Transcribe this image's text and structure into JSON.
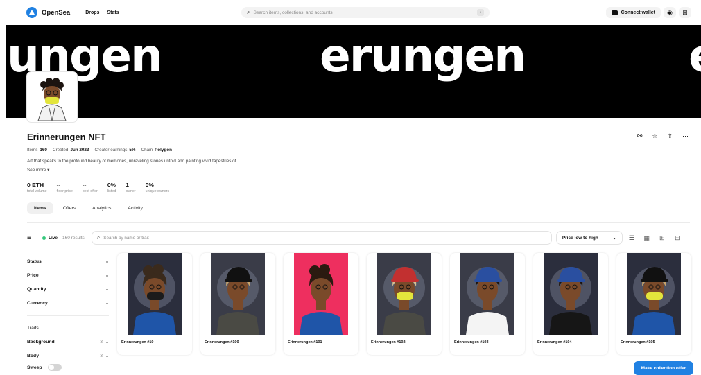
{
  "nav": {
    "logo_text": "OpenSea",
    "links": [
      "Drops",
      "Stats"
    ],
    "search_placeholder": "Search items, collections, and accounts",
    "search_shortcut": "/",
    "connect_wallet": "Connect wallet"
  },
  "banner": {
    "words": [
      "ungen",
      "erungen",
      "e"
    ]
  },
  "collection": {
    "title": "Erinnerungen NFT",
    "meta": {
      "items_label": "Items",
      "items_value": "160",
      "created_label": "Created",
      "created_value": "Jun 2023",
      "earnings_label": "Creator earnings",
      "earnings_value": "5%",
      "chain_label": "Chain",
      "chain_value": "Polygon"
    },
    "description": "Art that speaks to the profound beauty of memories, unraveling stories untold and painting vivid tapestries of...",
    "see_more": "See more",
    "stats": [
      {
        "value": "0 ETH",
        "label": "total volume"
      },
      {
        "value": "--",
        "label": "floor price"
      },
      {
        "value": "--",
        "label": "best offer"
      },
      {
        "value": "0%",
        "label": "listed"
      },
      {
        "value": "1",
        "label": "owner"
      },
      {
        "value": "0%",
        "label": "unique owners"
      }
    ]
  },
  "tabs": [
    "Items",
    "Offers",
    "Analytics",
    "Activity"
  ],
  "filter_bar": {
    "live": "Live",
    "results": "160 results",
    "search_placeholder": "Search by name or trait",
    "sort": "Price low to high"
  },
  "sidebar": {
    "filters": [
      "Status",
      "Price",
      "Quantity",
      "Currency"
    ],
    "traits_label": "Traits",
    "traits": [
      {
        "name": "Background",
        "count": "3"
      },
      {
        "name": "Body",
        "count": "3"
      }
    ]
  },
  "items": [
    {
      "name": "Erinnerungen #10",
      "bg": "#2b2e3d",
      "hair": "#3a2a1c",
      "mask": "#1b1b1b",
      "shirt": "#1f55a8",
      "cap": ""
    },
    {
      "name": "Erinnerungen #100",
      "bg": "#3a3c48",
      "hair": "#c9a46a",
      "mask": "",
      "shirt": "#4a4a44",
      "cap": "#111111"
    },
    {
      "name": "Erinnerungen #101",
      "bg": "#ee2f5f",
      "hair": "#2b1a10",
      "mask": "",
      "shirt": "#1f55a8",
      "cap": ""
    },
    {
      "name": "Erinnerungen #102",
      "bg": "#3a3c48",
      "hair": "#d8c090",
      "mask": "#e3e53c",
      "shirt": "#4a4a44",
      "cap": "#c23030"
    },
    {
      "name": "Erinnerungen #103",
      "bg": "#3a3c48",
      "hair": "#1e140d",
      "mask": "",
      "shirt": "#f4f4f4",
      "cap": "#2a4fa0"
    },
    {
      "name": "Erinnerungen #104",
      "bg": "#2b2e3d",
      "hair": "#1e140d",
      "mask": "",
      "shirt": "#161616",
      "cap": "#2a4fa0"
    },
    {
      "name": "Erinnerungen #105",
      "bg": "#2b2e3d",
      "hair": "#c9a46a",
      "mask": "#e3e53c",
      "shirt": "#1f55a8",
      "cap": "#111111"
    }
  ],
  "bottom": {
    "sweep": "Sweep",
    "offer_button": "Make collection offer"
  }
}
